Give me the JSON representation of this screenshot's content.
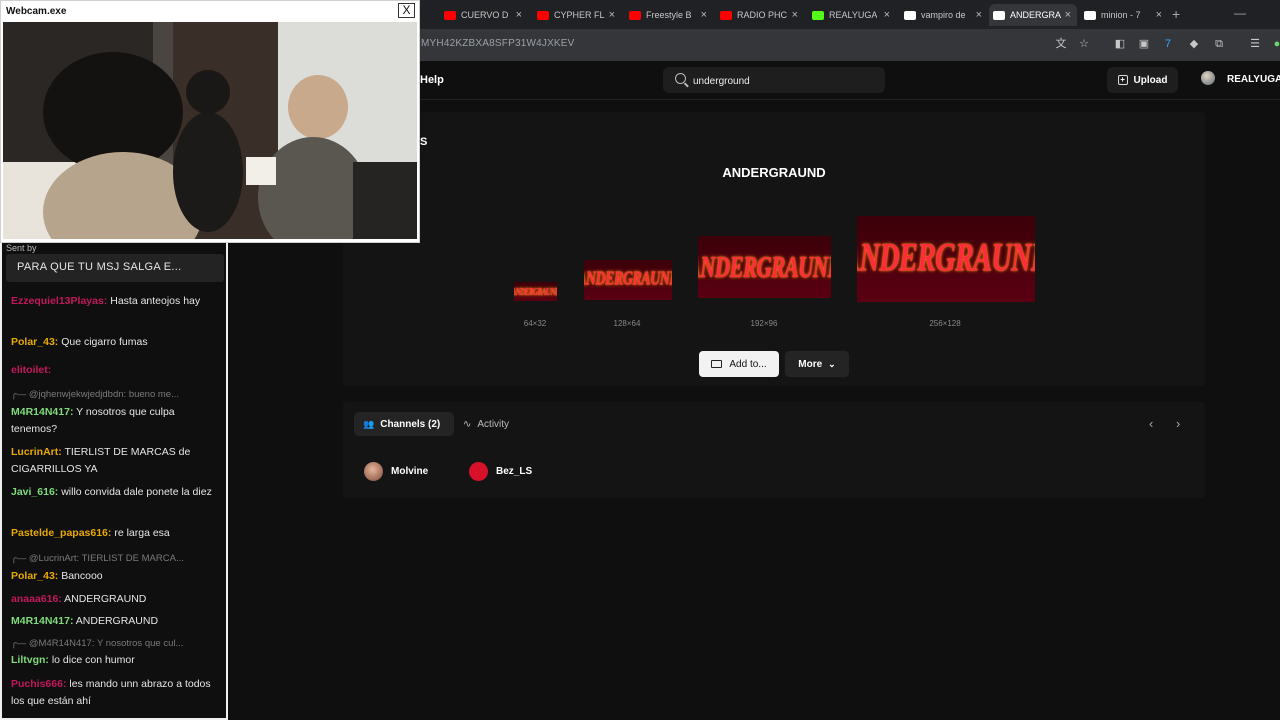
{
  "browser": {
    "tabs": [
      {
        "title": "CUERVO D",
        "icon": "youtube-icon",
        "color": "#ff0000"
      },
      {
        "title": "CYPHER FL",
        "icon": "youtube-icon",
        "color": "#ff0000"
      },
      {
        "title": "Freestyle B",
        "icon": "youtube-icon",
        "color": "#ff0000"
      },
      {
        "title": "RADIO PHC",
        "icon": "youtube-icon",
        "color": "#ff0000"
      },
      {
        "title": "REALYUGA",
        "icon": "kick-icon",
        "color": "#53fc18"
      },
      {
        "title": "vampiro de",
        "icon": "google-icon",
        "color": "#ffffff"
      },
      {
        "title": "ANDERGRA",
        "icon": "7tv-icon",
        "color": "#ffffff"
      },
      {
        "title": "minion - 7",
        "icon": "7tv-icon",
        "color": "#ffffff"
      }
    ],
    "url_fragment": "MYH42KZBXA8SFP31W4JXKEV"
  },
  "site": {
    "nav_help": "Help",
    "search_value": "underground",
    "upload_label": "Upload",
    "username": "REALYUGA",
    "section_fragment": "S"
  },
  "emote": {
    "title": "ANDERGRAUND",
    "image_text": "ANDERGRAUND",
    "sizes": [
      "64×32",
      "128×64",
      "192×96",
      "256×128"
    ],
    "add_to_label": "Add to...",
    "more_label": "More"
  },
  "channels": {
    "tab_channels": "Channels (2)",
    "tab_activity": "Activity",
    "list": [
      {
        "name": "Molvine"
      },
      {
        "name": "Bez_LS"
      }
    ]
  },
  "webcam": {
    "title": "Webcam.exe",
    "close": "X"
  },
  "chat": {
    "sent_by": "Sent by",
    "pinned": "PARA QUE TU MSJ SALGA E...",
    "messages": [
      {
        "user": "Ezzequiel13Playas:",
        "text": " Hasta anteojos hay",
        "color": "#c2185b"
      },
      {
        "user": "Polar_43:",
        "text": " Que cigarro fumas",
        "color": "#e8a900"
      },
      {
        "user": "elitoilet:",
        "text": "",
        "color": "#c2185b"
      },
      {
        "user": "",
        "text": "@jqhenwjekwjedjdbdn: bueno me...",
        "color": "#7a7a7a"
      },
      {
        "user": "M4R14N417:",
        "text": " Y nosotros que culpa tenemos?",
        "color": "#7ddc7b"
      },
      {
        "user": "LucrinArt:",
        "text": " TIERLIST DE MARCAS de CIGARRILLOS YA",
        "color": "#e8a900"
      },
      {
        "user": "Javi_616:",
        "text": " willo convida dale ponete la diez",
        "color": "#7ddc7b"
      },
      {
        "user": "Pastelde_papas616:",
        "text": " re larga esa",
        "color": "#e8a900"
      },
      {
        "user": "",
        "text": "@LucrinArt: TIERLIST DE MARCA...",
        "color": "#7a7a7a"
      },
      {
        "user": "Polar_43:",
        "text": " Bancooo",
        "color": "#e8a900"
      },
      {
        "user": "anaaa616:",
        "text": " ANDERGRAUND",
        "color": "#c2185b"
      },
      {
        "user": "M4R14N417:",
        "text": " ANDERGRAUND",
        "color": "#7ddc7b"
      },
      {
        "user": "",
        "text": "@M4R14N417: Y nosotros que cul...",
        "color": "#7a7a7a"
      },
      {
        "user": "Liltvgn:",
        "text": " lo dice con humor",
        "color": "#7ddc7b"
      },
      {
        "user": "Puchis666:",
        "text": "  les mando unn abrazo a todos los que están ahí",
        "color": "#c2185b"
      }
    ]
  }
}
